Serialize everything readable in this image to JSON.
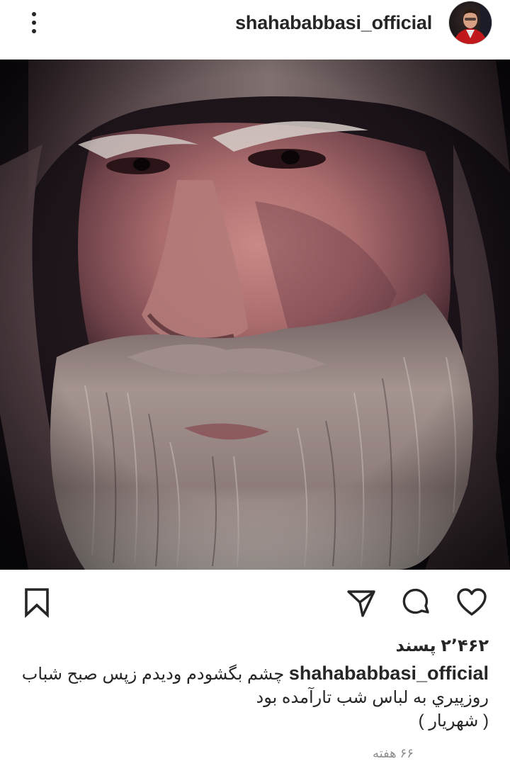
{
  "header": {
    "username": "shahababbasi_official",
    "more_icon": "more-vertical-icon",
    "avatar_icon": "profile-avatar"
  },
  "post": {
    "image_desc": "close-up portrait photo",
    "actions": {
      "like_icon": "heart-icon",
      "comment_icon": "comment-bubble-icon",
      "share_icon": "send-paper-plane-icon",
      "save_icon": "bookmark-icon"
    },
    "likes_text": "۲٬۴۶۲ پسند",
    "caption": {
      "username": "shahababbasi_official",
      "line1_text": "چشم بگشودم وديدم زپس صبح شباب",
      "line2": "روزپيري به لباس شب تارآمده بود",
      "line3": "( شهريار )"
    },
    "timestamp": "۶۶ هفته"
  },
  "colors": {
    "text": "#262626",
    "secondary": "#8e8e8e",
    "background": "#ffffff"
  }
}
